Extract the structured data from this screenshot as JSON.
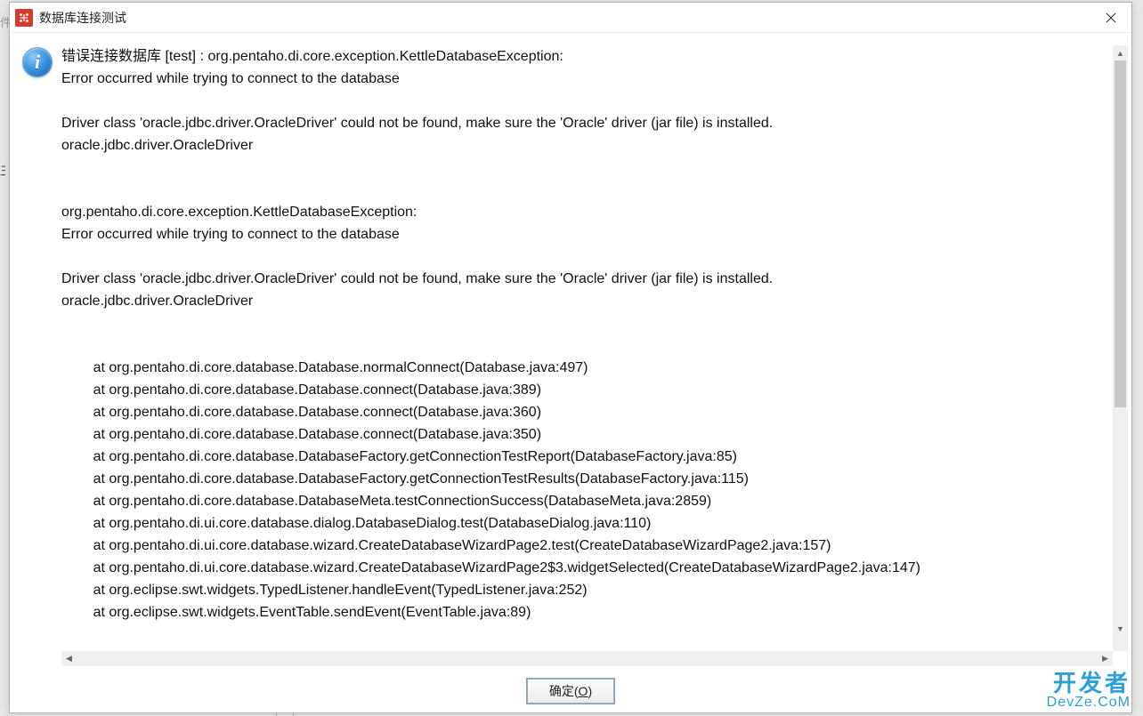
{
  "window": {
    "title": "数据库连接测试",
    "ok_label_pre": "确定(",
    "ok_mnemonic": "O",
    "ok_label_post": ")"
  },
  "message": {
    "lines": [
      "错误连接数据库 [test] : org.pentaho.di.core.exception.KettleDatabaseException: ",
      "Error occurred while trying to connect to the database",
      "",
      "Driver class 'oracle.jdbc.driver.OracleDriver' could not be found, make sure the 'Oracle' driver (jar file) is installed.",
      "oracle.jdbc.driver.OracleDriver",
      "",
      "",
      "org.pentaho.di.core.exception.KettleDatabaseException: ",
      "Error occurred while trying to connect to the database",
      "",
      "Driver class 'oracle.jdbc.driver.OracleDriver' could not be found, make sure the 'Oracle' driver (jar file) is installed.",
      "oracle.jdbc.driver.OracleDriver",
      "",
      ""
    ],
    "stack": [
      "at org.pentaho.di.core.database.Database.normalConnect(Database.java:497)",
      "at org.pentaho.di.core.database.Database.connect(Database.java:389)",
      "at org.pentaho.di.core.database.Database.connect(Database.java:360)",
      "at org.pentaho.di.core.database.Database.connect(Database.java:350)",
      "at org.pentaho.di.core.database.DatabaseFactory.getConnectionTestReport(DatabaseFactory.java:85)",
      "at org.pentaho.di.core.database.DatabaseFactory.getConnectionTestResults(DatabaseFactory.java:115)",
      "at org.pentaho.di.core.database.DatabaseMeta.testConnectionSuccess(DatabaseMeta.java:2859)",
      "at org.pentaho.di.ui.core.database.dialog.DatabaseDialog.test(DatabaseDialog.java:110)",
      "at org.pentaho.di.ui.core.database.wizard.CreateDatabaseWizardPage2.test(CreateDatabaseWizardPage2.java:157)",
      "at org.pentaho.di.ui.core.database.wizard.CreateDatabaseWizardPage2$3.widgetSelected(CreateDatabaseWizardPage2.java:147)",
      "at org.eclipse.swt.widgets.TypedListener.handleEvent(TypedListener.java:252)",
      "at org.eclipse.swt.widgets.EventTable.sendEvent(EventTable.java:89)"
    ]
  },
  "watermark": {
    "l1": "开发者",
    "l2": "DevZe.CoM"
  },
  "bg_hints": {
    "a": "件",
    "b": "主"
  }
}
